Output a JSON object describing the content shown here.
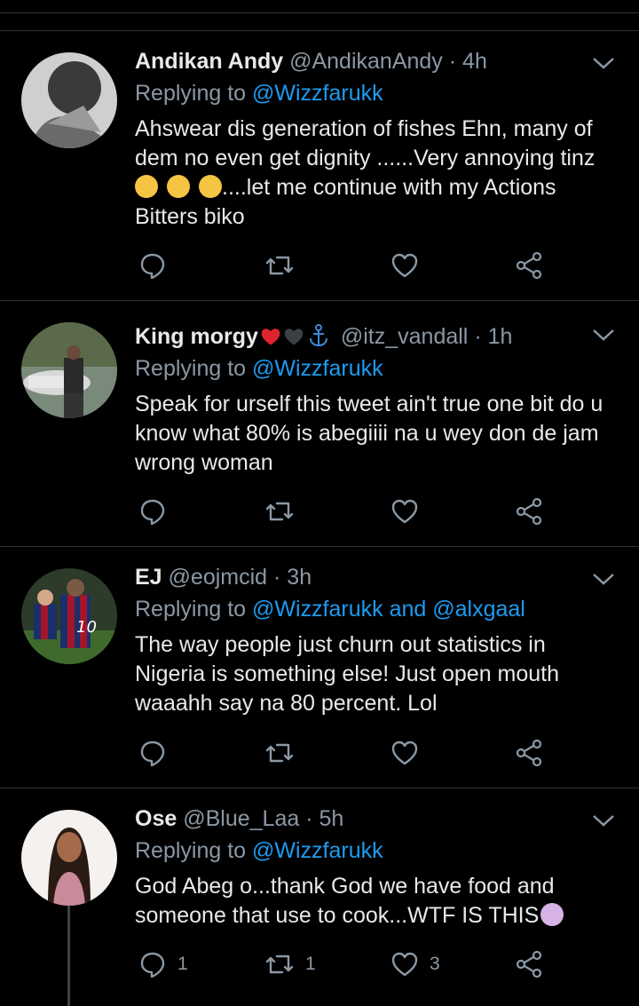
{
  "colors": {
    "background": "#000000",
    "text": "#e7e9ea",
    "muted": "#8b98a5",
    "link": "#1d9bf0",
    "divider": "#2f3336"
  },
  "tweets": [
    {
      "name": "Andikan Andy",
      "handle": "@AndikanAndy",
      "time": "· 4h",
      "replying_prefix": "Replying to ",
      "replying_to": "@Wizzfarukk",
      "line1": "Ahswear dis generation of fishes Ehn, many of",
      "line2": "dem no even get dignity ......Very annoying tinz",
      "line3": "....let me continue with my Actions",
      "line4": "Bitters biko",
      "emojis": [
        "angry-face",
        "face-with-tears-of-joy",
        "face-with-tears-of-joy"
      ]
    },
    {
      "name": "King morgy",
      "name_icons": [
        "red-heart",
        "black-heart",
        "anchor"
      ],
      "handle": "@itz_vandall",
      "time": "· 1h",
      "replying_prefix": "Replying to ",
      "replying_to": "@Wizzfarukk",
      "line1": "Speak for urself this tweet ain't true one bit do u",
      "line2": "know what 80% is abegiiii na u wey don de jam",
      "line3": "wrong woman"
    },
    {
      "name": "EJ",
      "handle": "@eojmcid",
      "time": "· 3h",
      "replying_prefix": "Replying to ",
      "replying_to": "@Wizzfarukk",
      "replying_and": " and ",
      "replying_to2": "@alxgaal",
      "line1": "The way people just churn out statistics in",
      "line2": "Nigeria is something else! Just open mouth",
      "line3": "waaahh say na 80 percent. Lol"
    },
    {
      "name": "Ose",
      "handle": "@Blue_Laa",
      "time": "· 5h",
      "replying_prefix": "Replying to ",
      "replying_to": "@Wizzfarukk",
      "line1": "God Abeg o...thank God we have food and",
      "line2": "someone that use to cook...WTF IS THIS",
      "emoji": "woman-facepalming",
      "reply_count": "1",
      "retweet_count": "1",
      "like_count": "3"
    }
  ],
  "icons": {
    "reply": "reply-icon",
    "retweet": "retweet-icon",
    "like": "like-icon",
    "share": "share-icon",
    "more": "chevron-down-icon"
  }
}
